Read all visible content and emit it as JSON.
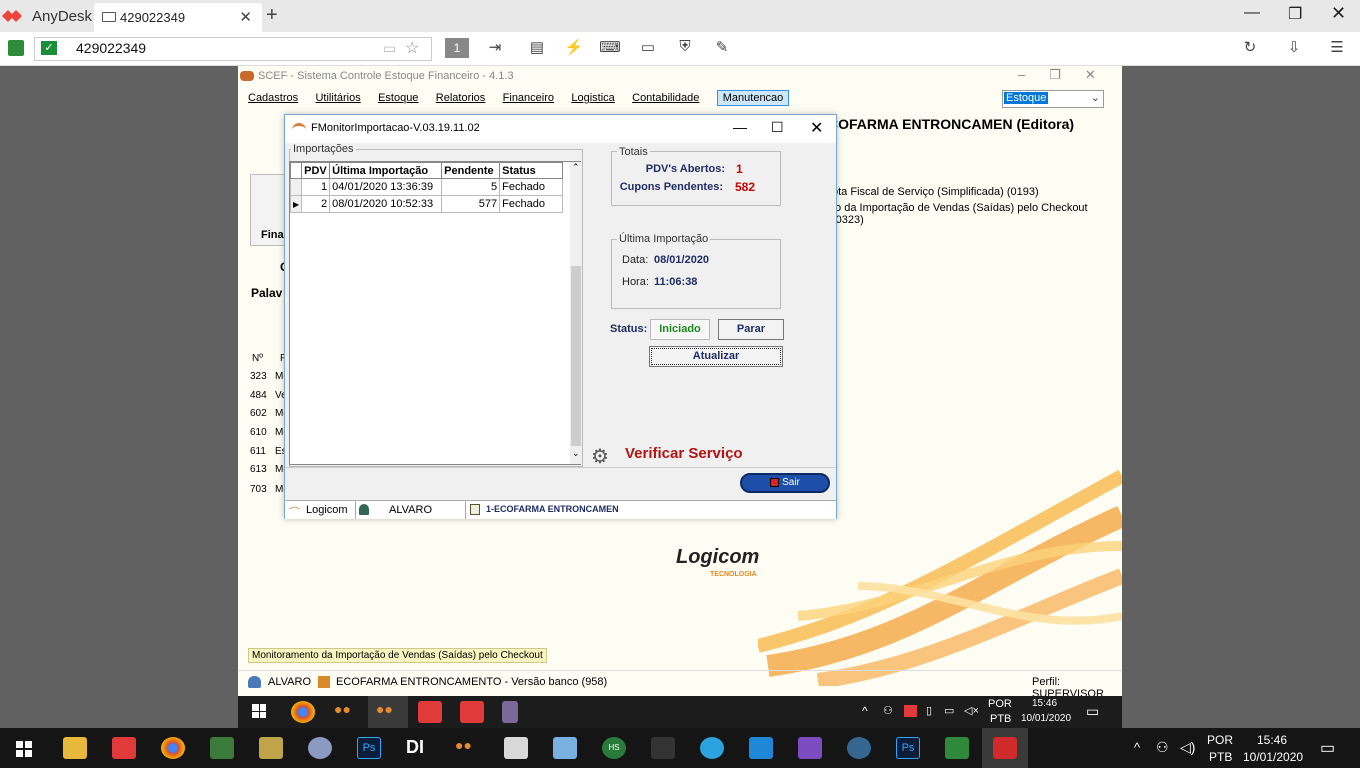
{
  "anydesk": {
    "app_name": "AnyDesk",
    "tab_label": "429022349",
    "address_value": "429022349",
    "toolbar_badge": "1"
  },
  "scef": {
    "window_title": "SCEF - Sistema Controle Estoque Financeiro - 4.1.3",
    "menu": [
      "Cadastros",
      "Utilitários",
      "Estoque",
      "Relatorios",
      "Financeiro",
      "Logistica",
      "Contabilidade",
      "Manutencao"
    ],
    "combo_value": "Estoque",
    "heading": "COFARMA ENTRONCAMEN (Editora)",
    "info_lines": [
      "ota Fiscal de Serviço (Simplificada) (0193)",
      "to da Importação de Vendas (Saídas) pelo Checkout (0323)"
    ],
    "fin_label": "Finan",
    "c_label": "C",
    "palav_label": "Palav",
    "rows_header": [
      "Nº",
      "F"
    ],
    "rows": [
      {
        "num": "323",
        "chr": "Mc"
      },
      {
        "num": "484",
        "chr": "Ve"
      },
      {
        "num": "602",
        "chr": "Mc"
      },
      {
        "num": "610",
        "chr": "Mc"
      },
      {
        "num": "611",
        "chr": "Es"
      },
      {
        "num": "613",
        "chr": "Mc"
      },
      {
        "num": "703",
        "chr": "Mc"
      }
    ],
    "status_message": "Monitoramento da Importação de Vendas (Saídas) pelo Checkout",
    "user": "ALVARO",
    "firm_version": "ECOFARMA ENTRONCAMENTO - Versão banco (958)",
    "perfil": "Perfil: SUPERVISOR",
    "logo_text": "Logicom",
    "logo_sub": "TECNOLOGIA"
  },
  "dialog": {
    "title": "FMonitorImportacao-V.03.19.11.02",
    "importacoes_label": "Importações",
    "columns": [
      "PDV",
      "Última Importação",
      "Pendente",
      "Status"
    ],
    "rows": [
      {
        "pdv": "1",
        "ultima": "04/01/2020 13:36:39",
        "pendente": "5",
        "status": "Fechado"
      },
      {
        "pdv": "2",
        "ultima": "08/01/2020 10:52:33",
        "pendente": "577",
        "status": "Fechado"
      }
    ],
    "totais_label": "Totais",
    "pdv_abertos_label": "PDV's Abertos:",
    "pdv_abertos_value": "1",
    "cupons_label": "Cupons Pendentes:",
    "cupons_value": "582",
    "ultima_label": "Última Importação",
    "data_label": "Data:",
    "data_value": "08/01/2020",
    "hora_label": "Hora:",
    "hora_value": "11:06:38",
    "status_label": "Status:",
    "status_value": "Iniciado",
    "parar_label": "Parar",
    "atualizar_label": "Atualizar",
    "verificar_label": "Verificar Serviço",
    "sair_label": "Sair",
    "footer_app": "Logicom",
    "footer_user": "ALVARO",
    "footer_firm": "1-ECOFARMA ENTRONCAMEN"
  },
  "remote_tray": {
    "lang": "POR",
    "layout": "PTB",
    "time": "15:46",
    "date": "10/01/2020"
  },
  "host_tray": {
    "lang": "POR",
    "layout": "PTB",
    "time": "15:46",
    "date": "10/01/2020"
  }
}
